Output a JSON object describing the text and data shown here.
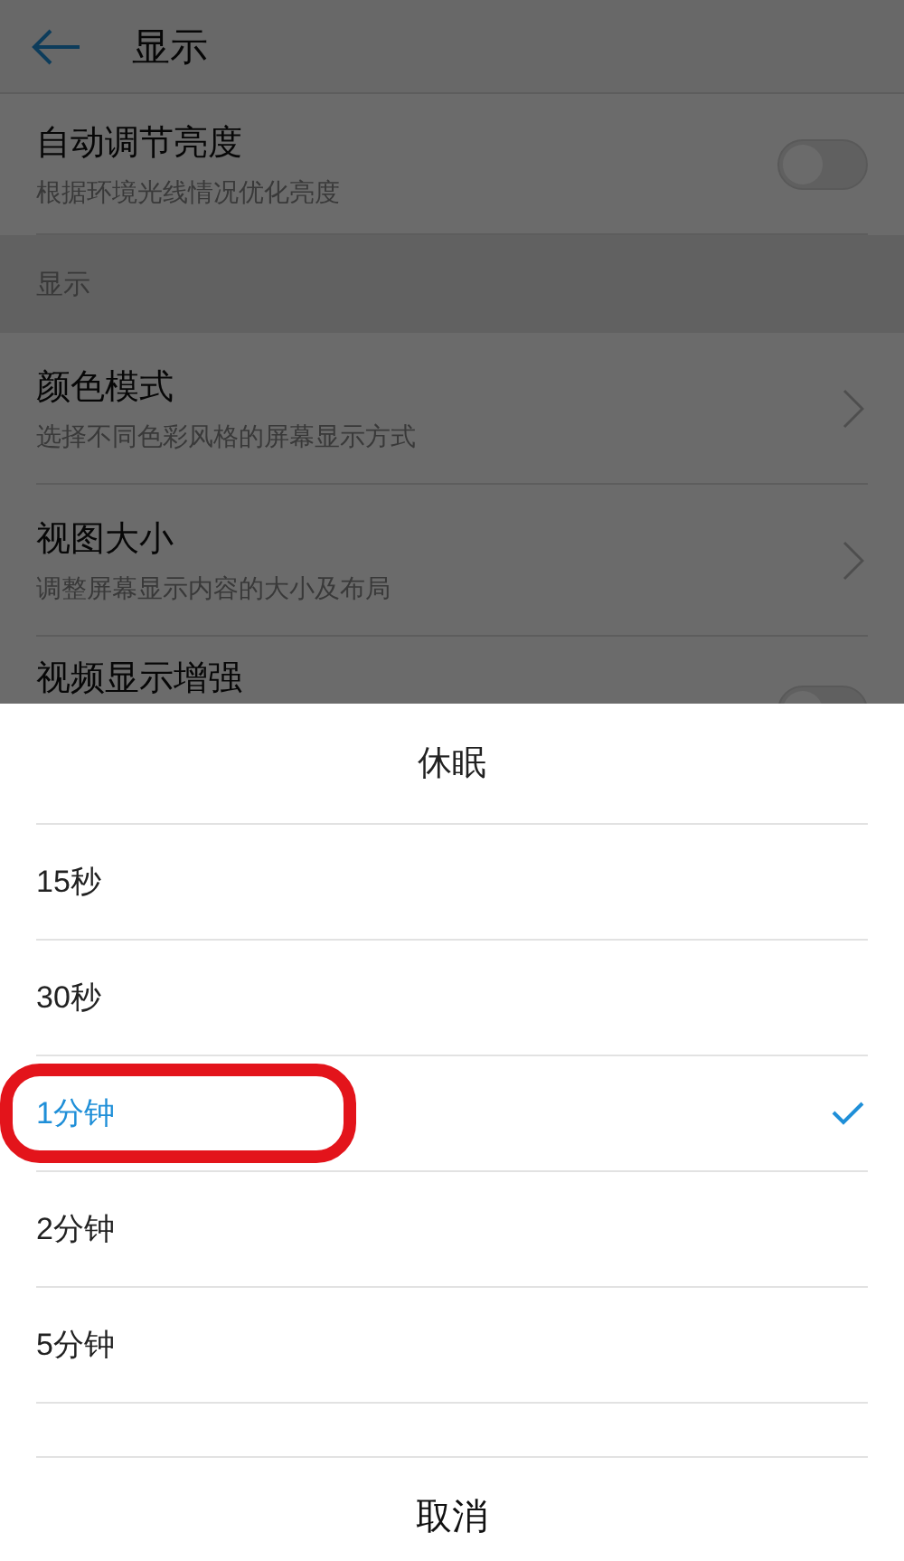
{
  "header": {
    "title": "显示"
  },
  "settings": [
    {
      "kind": "toggle",
      "title": "自动调节亮度",
      "subtitle": "根据环境光线情况优化亮度",
      "on": false
    },
    {
      "kind": "section",
      "title": "显示"
    },
    {
      "kind": "link",
      "title": "颜色模式",
      "subtitle": "选择不同色彩风格的屏幕显示方式"
    },
    {
      "kind": "link",
      "title": "视图大小",
      "subtitle": "调整屏幕显示内容的大小及布局"
    },
    {
      "kind": "toggle",
      "title": "视频显示增强",
      "on": false
    }
  ],
  "dialog": {
    "title": "休眠",
    "options": [
      {
        "label": "15秒",
        "selected": false,
        "annotated": false
      },
      {
        "label": "30秒",
        "selected": false,
        "annotated": false
      },
      {
        "label": "1分钟",
        "selected": true,
        "annotated": true
      },
      {
        "label": "2分钟",
        "selected": false,
        "annotated": false
      },
      {
        "label": "5分钟",
        "selected": false,
        "annotated": false
      }
    ],
    "cancel": "取消"
  }
}
